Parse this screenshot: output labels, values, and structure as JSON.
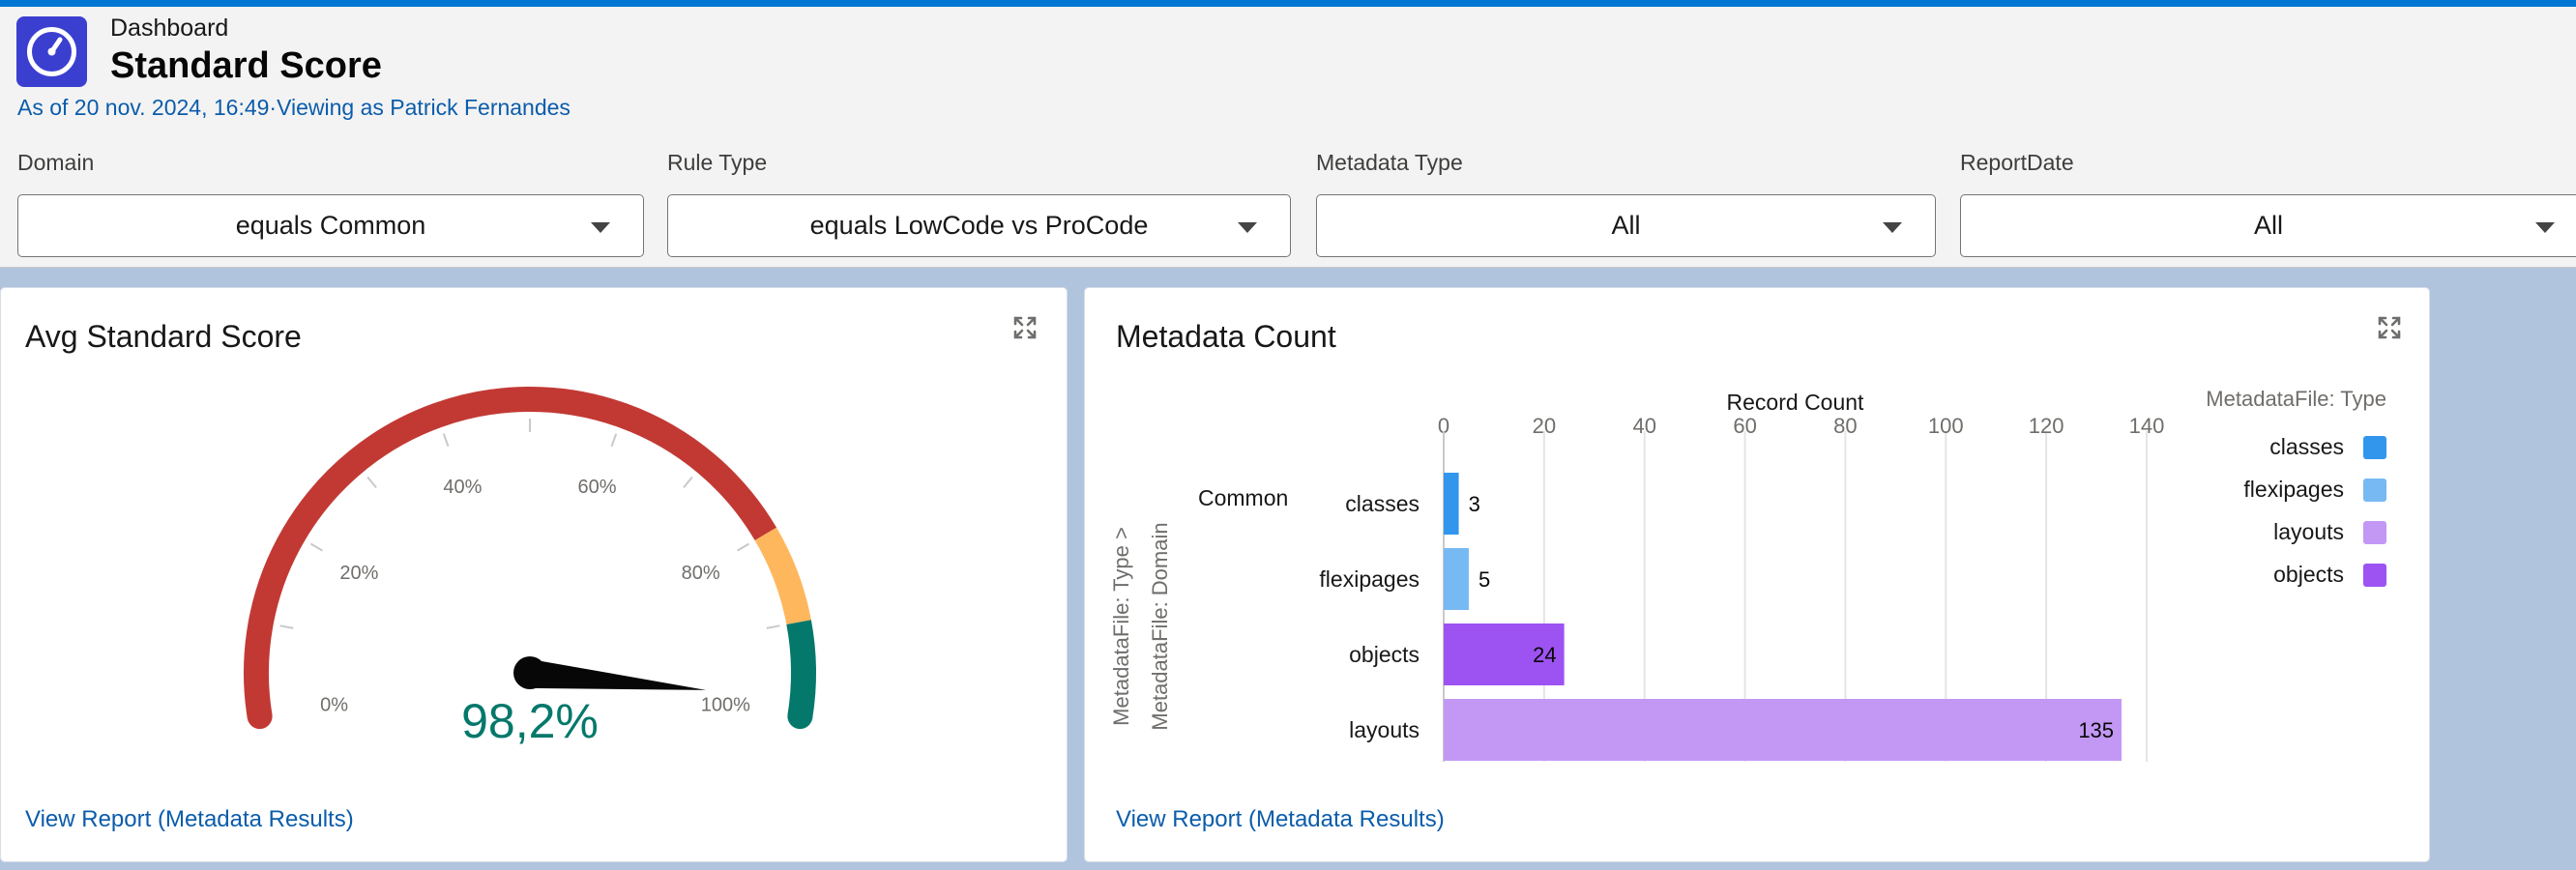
{
  "header": {
    "dashboard_label": "Dashboard",
    "title": "Standard Score",
    "as_of": "As of 20 nov. 2024, 16:49·Viewing as Patrick Fernandes",
    "app_icon": "gauge-icon",
    "accent_color": "#0176d3"
  },
  "filters": [
    {
      "label": "Domain",
      "value": "equals Common"
    },
    {
      "label": "Rule Type",
      "value": "equals LowCode vs ProCode"
    },
    {
      "label": "Metadata Type",
      "value": "All"
    },
    {
      "label": "ReportDate",
      "value": "All"
    }
  ],
  "gauge_panel": {
    "title": "Avg Standard Score",
    "value_label": "98,2%",
    "view_report": "View Report (Metadata Results)",
    "expand_icon": "expand-icon"
  },
  "bar_panel": {
    "title": "Metadata Count",
    "view_report": "View Report (Metadata Results)",
    "expand_icon": "expand-icon"
  },
  "chart_data": [
    {
      "type": "gauge",
      "value": 98.2,
      "min": 0,
      "max": 100,
      "tick_labels": [
        "0%",
        "20%",
        "40%",
        "60%",
        "80%",
        "100%"
      ],
      "bands": [
        {
          "from": 0,
          "to": 80,
          "color": "#c23934"
        },
        {
          "from": 80,
          "to": 90,
          "color": "#ffb75d"
        },
        {
          "from": 90,
          "to": 100,
          "color": "#04786b"
        }
      ],
      "value_color": "#04786b"
    },
    {
      "type": "bar",
      "orientation": "horizontal",
      "xlabel": "Record Count",
      "xlim": [
        0,
        140
      ],
      "xticks": [
        0,
        20,
        40,
        60,
        80,
        100,
        120,
        140
      ],
      "y_axis_labels": [
        "MetadataFile: Type >",
        "MetadataFile: Domain"
      ],
      "group": "Common",
      "categories": [
        "classes",
        "flexipages",
        "objects",
        "layouts"
      ],
      "values": [
        3,
        5,
        24,
        135
      ],
      "colors": [
        "#3296ed",
        "#77b9f2",
        "#9d53f2",
        "#c398f5"
      ],
      "legend_title": "MetadataFile: Type",
      "legend": [
        {
          "label": "classes",
          "color": "#3296ed"
        },
        {
          "label": "flexipages",
          "color": "#77b9f2"
        },
        {
          "label": "layouts",
          "color": "#c398f5"
        },
        {
          "label": "objects",
          "color": "#9d53f2"
        }
      ],
      "legend_position": "right",
      "grid": true
    }
  ]
}
